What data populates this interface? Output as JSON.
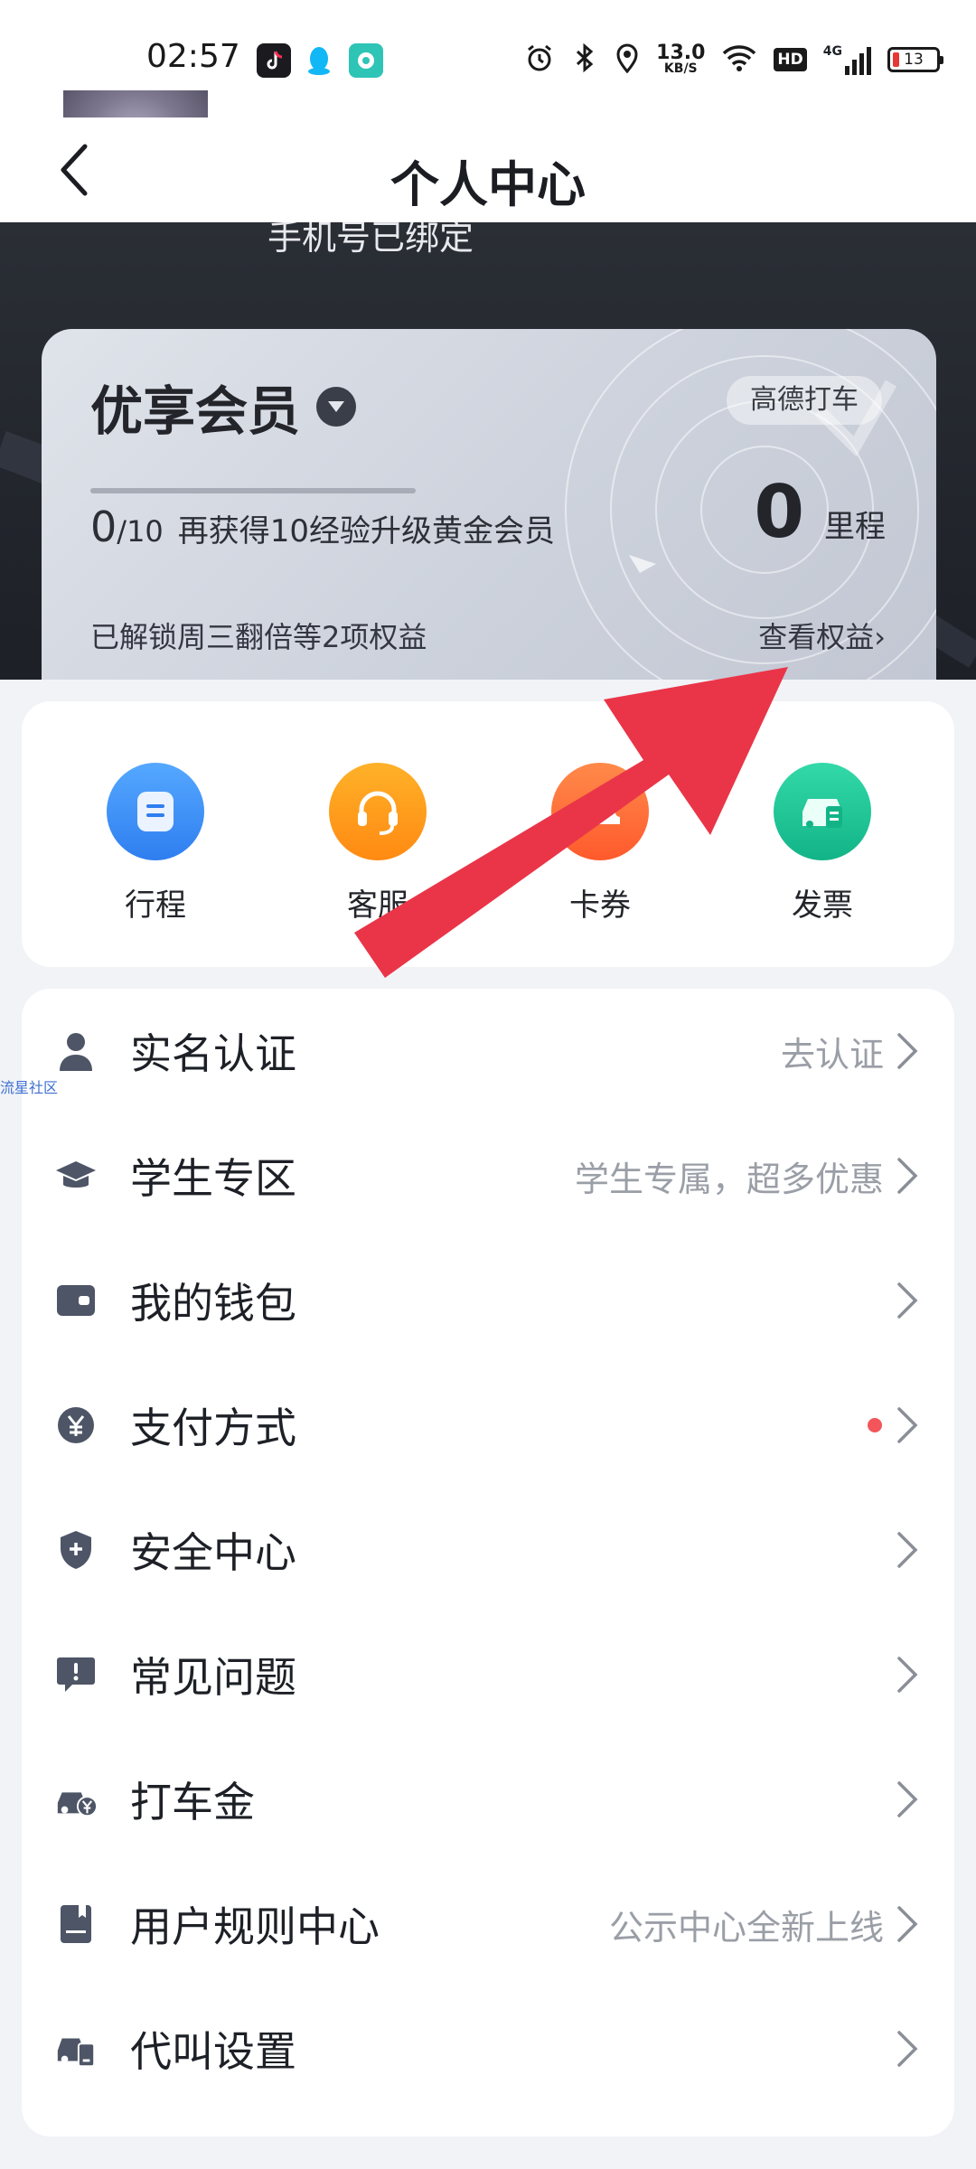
{
  "status_bar": {
    "time": "02:57",
    "speed_value": "13.0",
    "speed_unit": "KB/S",
    "hd": "HD",
    "network": "4G",
    "battery": "13",
    "icons": [
      "tiktok-icon",
      "qq-icon",
      "chat-app-icon",
      "alarm-icon",
      "bluetooth-icon",
      "location-icon",
      "wifi-icon",
      "signal-icon"
    ]
  },
  "nav": {
    "title": "个人中心",
    "back_icon": "chevron-left-icon"
  },
  "profile": {
    "bound_text": "手机号已绑定"
  },
  "member": {
    "title": "优享会员",
    "brand": "高德打车",
    "exp_current": "0",
    "exp_total": "/10",
    "exp_hint": "再获得10经验升级黄金会员",
    "progress": 0,
    "mileage": "0",
    "mileage_unit": "里程",
    "unlock_text": "已解锁周三翻倍等2项权益",
    "view_rights": "查看权益›"
  },
  "quick_actions": [
    {
      "label": "行程",
      "icon": "trip-icon",
      "color": "#3b8ff2"
    },
    {
      "label": "客服",
      "icon": "headset-icon",
      "color": "#ff9a1e"
    },
    {
      "label": "卡券",
      "icon": "coupon-icon",
      "color": "#ff6b3d"
    },
    {
      "label": "发票",
      "icon": "invoice-icon",
      "color": "#1fc79a"
    }
  ],
  "menu": [
    {
      "label": "实名认证",
      "hint": "去认证",
      "icon": "person-icon"
    },
    {
      "label": "学生专区",
      "hint": "学生专属，超多优惠",
      "icon": "graduation-cap-icon"
    },
    {
      "label": "我的钱包",
      "hint": "",
      "icon": "wallet-icon"
    },
    {
      "label": "支付方式",
      "hint": "",
      "icon": "yuan-icon",
      "badge": true
    },
    {
      "label": "安全中心",
      "hint": "",
      "icon": "shield-icon"
    },
    {
      "label": "常见问题",
      "hint": "",
      "icon": "faq-icon"
    },
    {
      "label": "打车金",
      "hint": "",
      "icon": "taxi-money-icon"
    },
    {
      "label": "用户规则中心",
      "hint": "公示中心全新上线",
      "icon": "rulebook-icon"
    },
    {
      "label": "代叫设置",
      "hint": "",
      "icon": "car-call-icon"
    }
  ],
  "watermark": "流星社区",
  "colors": {
    "accent_red": "#ea3548",
    "card_bg": "#ffffff",
    "page_bg": "#f1f3f7"
  }
}
